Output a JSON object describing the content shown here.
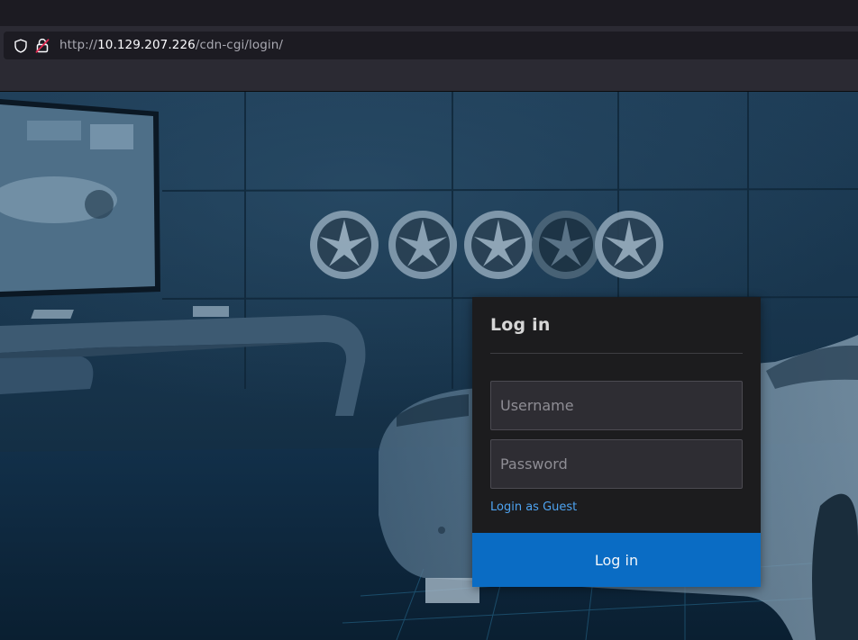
{
  "browser": {
    "url_scheme": "http://",
    "url_host": "10.129.207.226",
    "url_path": "/cdn-cgi/login/"
  },
  "login": {
    "title": "Log in",
    "username_placeholder": "Username",
    "password_placeholder": "Password",
    "guest_link": "Login as Guest",
    "submit_label": "Log in"
  },
  "colors": {
    "accent_button": "#0a6cc4",
    "link": "#4ea3f0",
    "card_bg": "#1c1c1e",
    "page_tint": "#0f2a40"
  },
  "icons": [
    "shield-icon",
    "lock-insecure-icon"
  ]
}
